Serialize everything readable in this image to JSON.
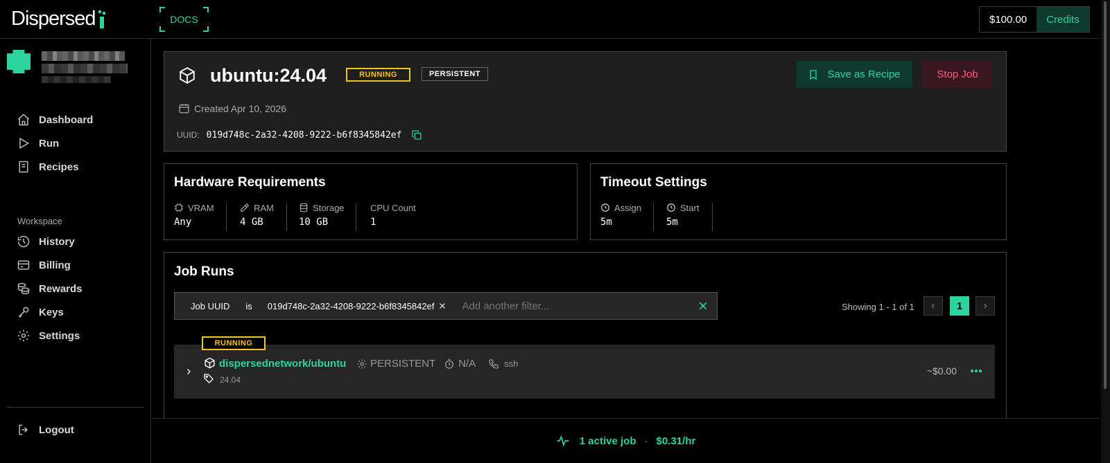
{
  "app": {
    "logo_text": "Dispersed"
  },
  "topbar": {
    "docs_label": "DOCS",
    "balance": "$100.00",
    "credits_label": "Credits"
  },
  "sidebar": {
    "items": [
      {
        "label": "Dashboard",
        "icon": "home-icon"
      },
      {
        "label": "Run",
        "icon": "play-icon"
      },
      {
        "label": "Recipes",
        "icon": "book-icon"
      }
    ],
    "workspace_label": "Workspace",
    "workspace_items": [
      {
        "label": "History",
        "icon": "history-icon"
      },
      {
        "label": "Billing",
        "icon": "card-icon"
      },
      {
        "label": "Rewards",
        "icon": "coins-icon"
      },
      {
        "label": "Keys",
        "icon": "key-icon"
      },
      {
        "label": "Settings",
        "icon": "gear-icon"
      }
    ],
    "logout_label": "Logout"
  },
  "job": {
    "title": "ubuntu:24.04",
    "status_badge": "RUNNING",
    "persistence_badge": "PERSISTENT",
    "created": "Created Apr 10, 2026",
    "uuid_label": "UUID:",
    "uuid": "019d748c-2a32-4208-9222-b6f8345842ef",
    "save_recipe_label": "Save as Recipe",
    "stop_label": "Stop Job"
  },
  "hardware": {
    "title": "Hardware Requirements",
    "specs": [
      {
        "label": "VRAM",
        "value": "Any"
      },
      {
        "label": "RAM",
        "value": "4 GB"
      },
      {
        "label": "Storage",
        "value": "10 GB"
      },
      {
        "label": "CPU Count",
        "value": "1"
      }
    ]
  },
  "timeout": {
    "title": "Timeout Settings",
    "specs": [
      {
        "label": "Assign",
        "value": "5m"
      },
      {
        "label": "Start",
        "value": "5m"
      }
    ]
  },
  "job_runs": {
    "title": "Job Runs",
    "filter": {
      "field": "Job UUID",
      "operator": "is",
      "value": "019d748c-2a32-4208-9222-b6f8345842ef",
      "placeholder": "Add another filter..."
    },
    "showing": "Showing 1 - 1 of 1",
    "page": "1",
    "run": {
      "status": "RUNNING",
      "image": "dispersednetwork/ubuntu",
      "persistence": "PERSISTENT",
      "timeout": "N/A",
      "access": "ssh",
      "tag": "24.04",
      "cost": "~$0.00"
    }
  },
  "footer": {
    "active_jobs": "1 active job",
    "separator": "·",
    "rate": "$0.31/hr"
  },
  "colors": {
    "accent": "#2dd4a0",
    "running": "#f5c518",
    "danger": "#ff5f7a",
    "card": "#1e1e1e"
  }
}
